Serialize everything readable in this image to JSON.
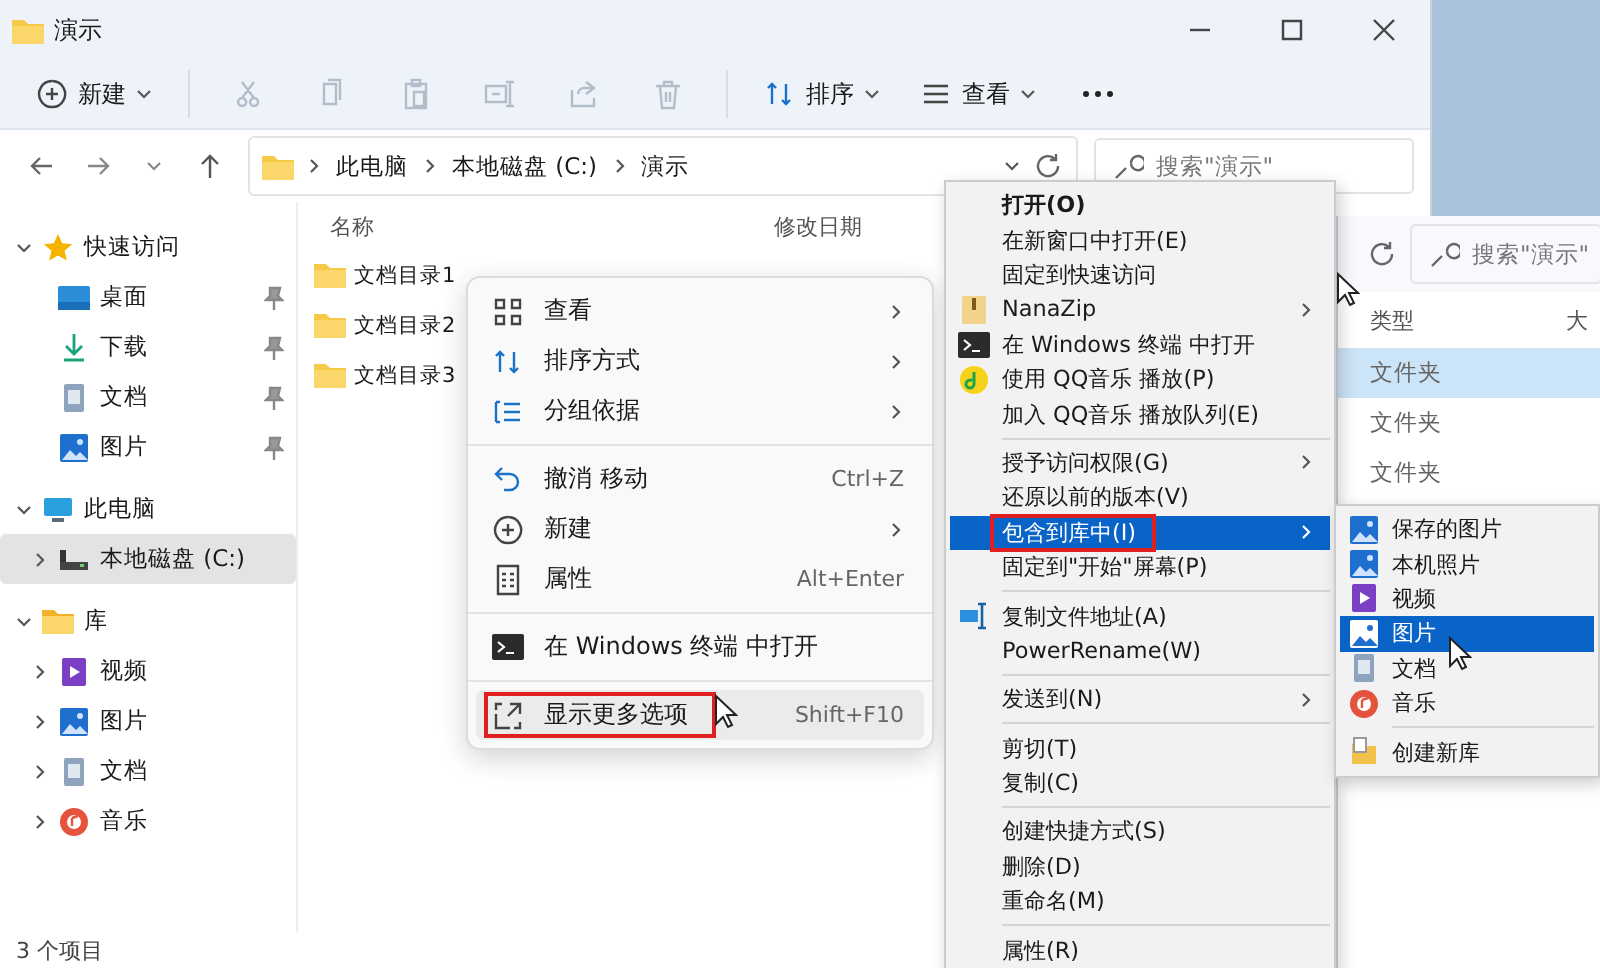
{
  "window": {
    "title": "演示"
  },
  "toolbar": {
    "new_button": {
      "label": "新建"
    },
    "icon_buttons": [
      {
        "disabled": true
      },
      {
        "disabled": true
      },
      {
        "disabled": true
      },
      {
        "disabled": true
      },
      {
        "disabled": true
      },
      {
        "disabled": true
      }
    ],
    "sort_button": {
      "label": "排序"
    },
    "view_button": {
      "label": "查看"
    }
  },
  "address_bar": {
    "path": [
      "此电脑",
      "本地磁盘 (C:)",
      "演示"
    ],
    "search": {
      "placeholder": "搜索\"演示\""
    }
  },
  "sidebar": {
    "items": [
      {
        "label": "快速访问",
        "expanded": true,
        "selected": false,
        "children": [
          {
            "label": "桌面",
            "pinned": true,
            "selected": false
          },
          {
            "label": "下载",
            "pinned": true,
            "selected": false
          },
          {
            "label": "文档",
            "pinned": true,
            "selected": false
          },
          {
            "label": "图片",
            "pinned": true,
            "selected": false
          }
        ]
      },
      {
        "label": "此电脑",
        "expanded": true,
        "selected": false,
        "children": [
          {
            "label": "本地磁盘 (C:)",
            "expanded": false,
            "selected": true
          }
        ]
      },
      {
        "label": "库",
        "expanded": true,
        "selected": false,
        "children": [
          {
            "label": "视频",
            "expanded": false,
            "selected": false
          },
          {
            "label": "图片",
            "expanded": false,
            "selected": false
          },
          {
            "label": "文档",
            "expanded": false,
            "selected": false
          },
          {
            "label": "音乐",
            "expanded": false,
            "selected": false
          }
        ]
      }
    ]
  },
  "file_list": {
    "columns": [
      "名称",
      "修改日期"
    ],
    "rows": [
      {
        "name": "文档目录1"
      },
      {
        "name": "文档目录2"
      },
      {
        "name": "文档目录3"
      }
    ]
  },
  "status_bar": {
    "text": "3 个项目"
  },
  "back_window": {
    "search": {
      "placeholder": "搜索\"演示\""
    },
    "columns": [
      "类型",
      "大"
    ],
    "rows": [
      {
        "type": "文件夹",
        "selected": true
      },
      {
        "type": "文件夹",
        "selected": false
      },
      {
        "type": "文件夹",
        "selected": false
      }
    ]
  },
  "context_menu": {
    "items": [
      {
        "kind": "item",
        "label": "查看",
        "has_submenu": true,
        "selected": false,
        "annotated": false
      },
      {
        "kind": "item",
        "label": "排序方式",
        "has_submenu": true,
        "selected": false,
        "annotated": false
      },
      {
        "kind": "item",
        "label": "分组依据",
        "has_submenu": true,
        "selected": false,
        "annotated": false
      },
      {
        "kind": "separator"
      },
      {
        "kind": "item",
        "label": "撤消 移动",
        "shortcut": "Ctrl+Z",
        "has_submenu": false,
        "selected": false,
        "annotated": false
      },
      {
        "kind": "item",
        "label": "新建",
        "has_submenu": true,
        "selected": false,
        "annotated": false
      },
      {
        "kind": "item",
        "label": "属性",
        "shortcut": "Alt+Enter",
        "has_submenu": false,
        "selected": false,
        "annotated": false
      },
      {
        "kind": "separator"
      },
      {
        "kind": "item",
        "label": "在 Windows 终端 中打开",
        "has_submenu": false,
        "selected": false,
        "annotated": false
      },
      {
        "kind": "separator"
      },
      {
        "kind": "item",
        "label": "显示更多选项",
        "shortcut": "Shift+F10",
        "has_submenu": false,
        "selected": true,
        "annotated": true
      }
    ]
  },
  "classic_menu": {
    "items": [
      {
        "kind": "item",
        "label": "打开(O)",
        "default": true,
        "has_submenu": false,
        "selected": false,
        "annotated": false
      },
      {
        "kind": "item",
        "label": "在新窗口中打开(E)",
        "default": false,
        "has_submenu": false,
        "selected": false,
        "annotated": false
      },
      {
        "kind": "item",
        "label": "固定到快速访问",
        "default": false,
        "has_submenu": false,
        "selected": false,
        "annotated": false
      },
      {
        "kind": "item",
        "label": "NanaZip",
        "default": false,
        "has_submenu": true,
        "selected": false,
        "annotated": false
      },
      {
        "kind": "item",
        "label": "在 Windows 终端 中打开",
        "default": false,
        "has_submenu": false,
        "selected": false,
        "annotated": false
      },
      {
        "kind": "item",
        "label": "使用 QQ音乐 播放(P)",
        "default": false,
        "has_submenu": false,
        "selected": false,
        "annotated": false
      },
      {
        "kind": "item",
        "label": "加入 QQ音乐 播放队列(E)",
        "default": false,
        "has_submenu": false,
        "selected": false,
        "annotated": false
      },
      {
        "kind": "separator"
      },
      {
        "kind": "item",
        "label": "授予访问权限(G)",
        "default": false,
        "has_submenu": true,
        "selected": false,
        "annotated": false
      },
      {
        "kind": "item",
        "label": "还原以前的版本(V)",
        "default": false,
        "has_submenu": false,
        "selected": false,
        "annotated": false
      },
      {
        "kind": "item",
        "label": "包含到库中(I)",
        "default": false,
        "has_submenu": true,
        "selected": true,
        "annotated": true
      },
      {
        "kind": "item",
        "label": "固定到\"开始\"屏幕(P)",
        "default": false,
        "has_submenu": false,
        "selected": false,
        "annotated": false
      },
      {
        "kind": "separator"
      },
      {
        "kind": "item",
        "label": "复制文件地址(A)",
        "default": false,
        "has_submenu": false,
        "selected": false,
        "annotated": false
      },
      {
        "kind": "item",
        "label": "PowerRename(W)",
        "default": false,
        "has_submenu": false,
        "selected": false,
        "annotated": false
      },
      {
        "kind": "separator"
      },
      {
        "kind": "item",
        "label": "发送到(N)",
        "default": false,
        "has_submenu": true,
        "selected": false,
        "annotated": false
      },
      {
        "kind": "separator"
      },
      {
        "kind": "item",
        "label": "剪切(T)",
        "default": false,
        "has_submenu": false,
        "selected": false,
        "annotated": false
      },
      {
        "kind": "item",
        "label": "复制(C)",
        "default": false,
        "has_submenu": false,
        "selected": false,
        "annotated": false
      },
      {
        "kind": "separator"
      },
      {
        "kind": "item",
        "label": "创建快捷方式(S)",
        "default": false,
        "has_submenu": false,
        "selected": false,
        "annotated": false
      },
      {
        "kind": "item",
        "label": "删除(D)",
        "default": false,
        "has_submenu": false,
        "selected": false,
        "annotated": false
      },
      {
        "kind": "item",
        "label": "重命名(M)",
        "default": false,
        "has_submenu": false,
        "selected": false,
        "annotated": false
      },
      {
        "kind": "separator"
      },
      {
        "kind": "item",
        "label": "属性(R)",
        "default": false,
        "has_submenu": false,
        "selected": false,
        "annotated": false
      }
    ]
  },
  "library_submenu": {
    "items": [
      {
        "kind": "item",
        "label": "保存的图片",
        "selected": false
      },
      {
        "kind": "item",
        "label": "本机照片",
        "selected": false
      },
      {
        "kind": "item",
        "label": "视频",
        "selected": false
      },
      {
        "kind": "item",
        "label": "图片",
        "selected": true
      },
      {
        "kind": "item",
        "label": "文档",
        "selected": false
      },
      {
        "kind": "item",
        "label": "音乐",
        "selected": false
      },
      {
        "kind": "separator"
      },
      {
        "kind": "item",
        "label": "创建新库",
        "selected": false
      }
    ]
  }
}
